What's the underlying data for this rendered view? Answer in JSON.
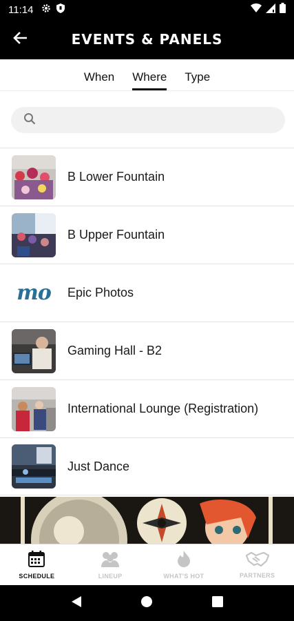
{
  "status_bar": {
    "time": "11:14",
    "icons_left": [
      "gear-icon",
      "shield-icon"
    ],
    "icons_right": [
      "wifi-icon",
      "signal-icon",
      "battery-icon"
    ]
  },
  "app_bar": {
    "title": "EVENTS & PANELS",
    "back_icon": "arrow-left-icon"
  },
  "tabs": [
    {
      "label": "When",
      "active": false
    },
    {
      "label": "Where",
      "active": true
    },
    {
      "label": "Type",
      "active": false
    }
  ],
  "search": {
    "placeholder": "",
    "value": "",
    "icon": "search-icon"
  },
  "locations": [
    {
      "label": "B Lower Fountain"
    },
    {
      "label": "B Upper Fountain"
    },
    {
      "label": "Epic Photos"
    },
    {
      "label": "Gaming Hall - B2"
    },
    {
      "label": "International Lounge (Registration)"
    },
    {
      "label": "Just Dance"
    }
  ],
  "bottom_nav": [
    {
      "label": "SCHEDULE",
      "icon": "calendar-icon",
      "active": true
    },
    {
      "label": "LINEUP",
      "icon": "people-icon",
      "active": false
    },
    {
      "label": "WHAT'S HOT",
      "icon": "flame-icon",
      "active": false
    },
    {
      "label": "PARTNERS",
      "icon": "handshake-icon",
      "active": false
    }
  ],
  "colors": {
    "header_bg": "#000000",
    "accent": "#111111",
    "inactive_nav": "#c5c5c5",
    "epic_photos_logo": "#2a6f97"
  },
  "banner": {
    "logo_text": "mo"
  }
}
